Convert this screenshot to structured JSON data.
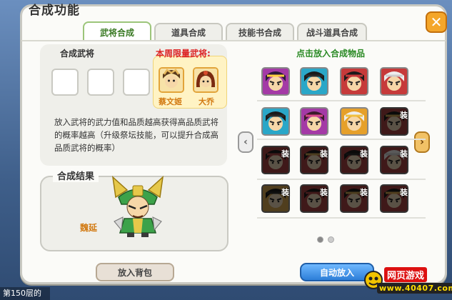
{
  "dialog": {
    "title": "合成功能",
    "close_label": "✕"
  },
  "tabs": [
    {
      "label": "武将合成",
      "active": true
    },
    {
      "label": "道具合成",
      "active": false
    },
    {
      "label": "技能书合成",
      "active": false
    },
    {
      "label": "战斗道具合成",
      "active": false
    }
  ],
  "synthesis": {
    "label": "合成武将",
    "weekly_limit_label": "本周限量武将:",
    "limited_heroes": [
      {
        "name": "蔡文姬",
        "colors": [
          "#f6d7a8",
          "#5a3a1c",
          "#e6b85c"
        ]
      },
      {
        "name": "大乔",
        "colors": [
          "#f6d7a8",
          "#7a2a10",
          "#d84a2a"
        ]
      }
    ],
    "description": "放入武将的武力值和品质越高获得高品质武将的概率越高（升级祭坛技能，可以提升合成高品质武将的概率）"
  },
  "result": {
    "label": "合成结果",
    "hero_name": "魏延"
  },
  "items_panel": {
    "title": "点击放入合成物品",
    "items": [
      {
        "row": 0,
        "col": 0,
        "locked": false,
        "bg": "#a43aa6",
        "hair": "#2a1a3a",
        "band": "#ffd040"
      },
      {
        "row": 0,
        "col": 1,
        "locked": false,
        "bg": "#2aa7c8",
        "hair": "#1a1a1a",
        "band": "#2a2a2a"
      },
      {
        "row": 0,
        "col": 2,
        "locked": false,
        "bg": "#c63a3a",
        "hair": "#1a1a1a",
        "band": "#c63a3a"
      },
      {
        "row": 0,
        "col": 3,
        "locked": false,
        "bg": "#c63a3a",
        "hair": "#eeeeee",
        "band": "#cccccc"
      },
      {
        "row": 1,
        "col": 0,
        "locked": false,
        "bg": "#2aa7c8",
        "hair": "#1a1a1a",
        "band": "#2a2a2a"
      },
      {
        "row": 1,
        "col": 1,
        "locked": false,
        "bg": "#a43aa6",
        "hair": "#3a1a2a",
        "band": "#d84a8a"
      },
      {
        "row": 1,
        "col": 2,
        "locked": false,
        "bg": "#e6a02a",
        "hair": "#eeeeee",
        "band": "#f0c040"
      },
      {
        "row": 1,
        "col": 3,
        "locked": true,
        "bg": "#c63a3a",
        "hair": "#1a1a1a",
        "band": "#d8a030"
      },
      {
        "row": 2,
        "col": 0,
        "locked": true,
        "bg": "#c63a3a",
        "hair": "#1a1a1a",
        "band": "#c63a3a"
      },
      {
        "row": 2,
        "col": 1,
        "locked": true,
        "bg": "#c63a3a",
        "hair": "#1a1a1a",
        "band": "#d8a030"
      },
      {
        "row": 2,
        "col": 2,
        "locked": true,
        "bg": "#c63a3a",
        "hair": "#1a1a1a",
        "band": "#2a2a2a"
      },
      {
        "row": 2,
        "col": 3,
        "locked": true,
        "bg": "#c63a3a",
        "hair": "#eeeeee",
        "band": "#cccccc"
      },
      {
        "row": 3,
        "col": 0,
        "locked": true,
        "bg": "#e6a02a",
        "hair": "#1a1a1a",
        "band": "#2a2a2a"
      },
      {
        "row": 3,
        "col": 1,
        "locked": true,
        "bg": "#c63a3a",
        "hair": "#1a1a1a",
        "band": "#c63a3a"
      },
      {
        "row": 3,
        "col": 2,
        "locked": true,
        "bg": "#c63a3a",
        "hair": "#1a1a1a",
        "band": "#d8a030"
      },
      {
        "row": 3,
        "col": 3,
        "locked": true,
        "bg": "#c63a3a",
        "hair": "#1a1a1a",
        "band": "#e6a02a"
      }
    ],
    "locked_tag": "装",
    "prev_icon": "chevron-left-icon",
    "next_icon": "chevron-right-icon",
    "pages": [
      {
        "active": true
      },
      {
        "active": false
      }
    ]
  },
  "buttons": {
    "put_bag": "放入背包",
    "auto_put": "自动放入"
  },
  "background": {
    "floor_label": "第150层的"
  },
  "watermark": {
    "title": "网页游戏",
    "url": "www.40407.com"
  },
  "colors": {
    "accent_green": "#2a8a24",
    "limit_red": "#d22222",
    "name_orange": "#d27a12",
    "auto_button_blue": "#2c7ed8"
  }
}
